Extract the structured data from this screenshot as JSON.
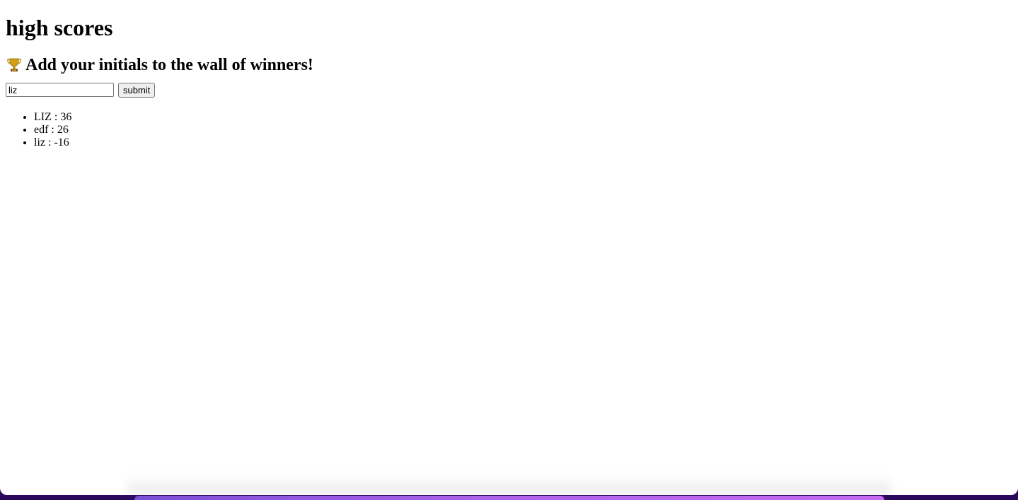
{
  "page": {
    "title": "high scores",
    "subtitle": "Add your initials to the wall of winners!",
    "trophy_icon": "trophy-icon"
  },
  "form": {
    "input_value": "liz",
    "submit_label": "submit"
  },
  "scores": [
    {
      "text": "LIZ : 36"
    },
    {
      "text": "edf : 26"
    },
    {
      "text": "liz : -16"
    }
  ],
  "colors": {
    "background_desktop": "#2a0a5e",
    "dock_gradient_start": "#7b4fd6",
    "dock_gradient_end": "#c56af0"
  }
}
